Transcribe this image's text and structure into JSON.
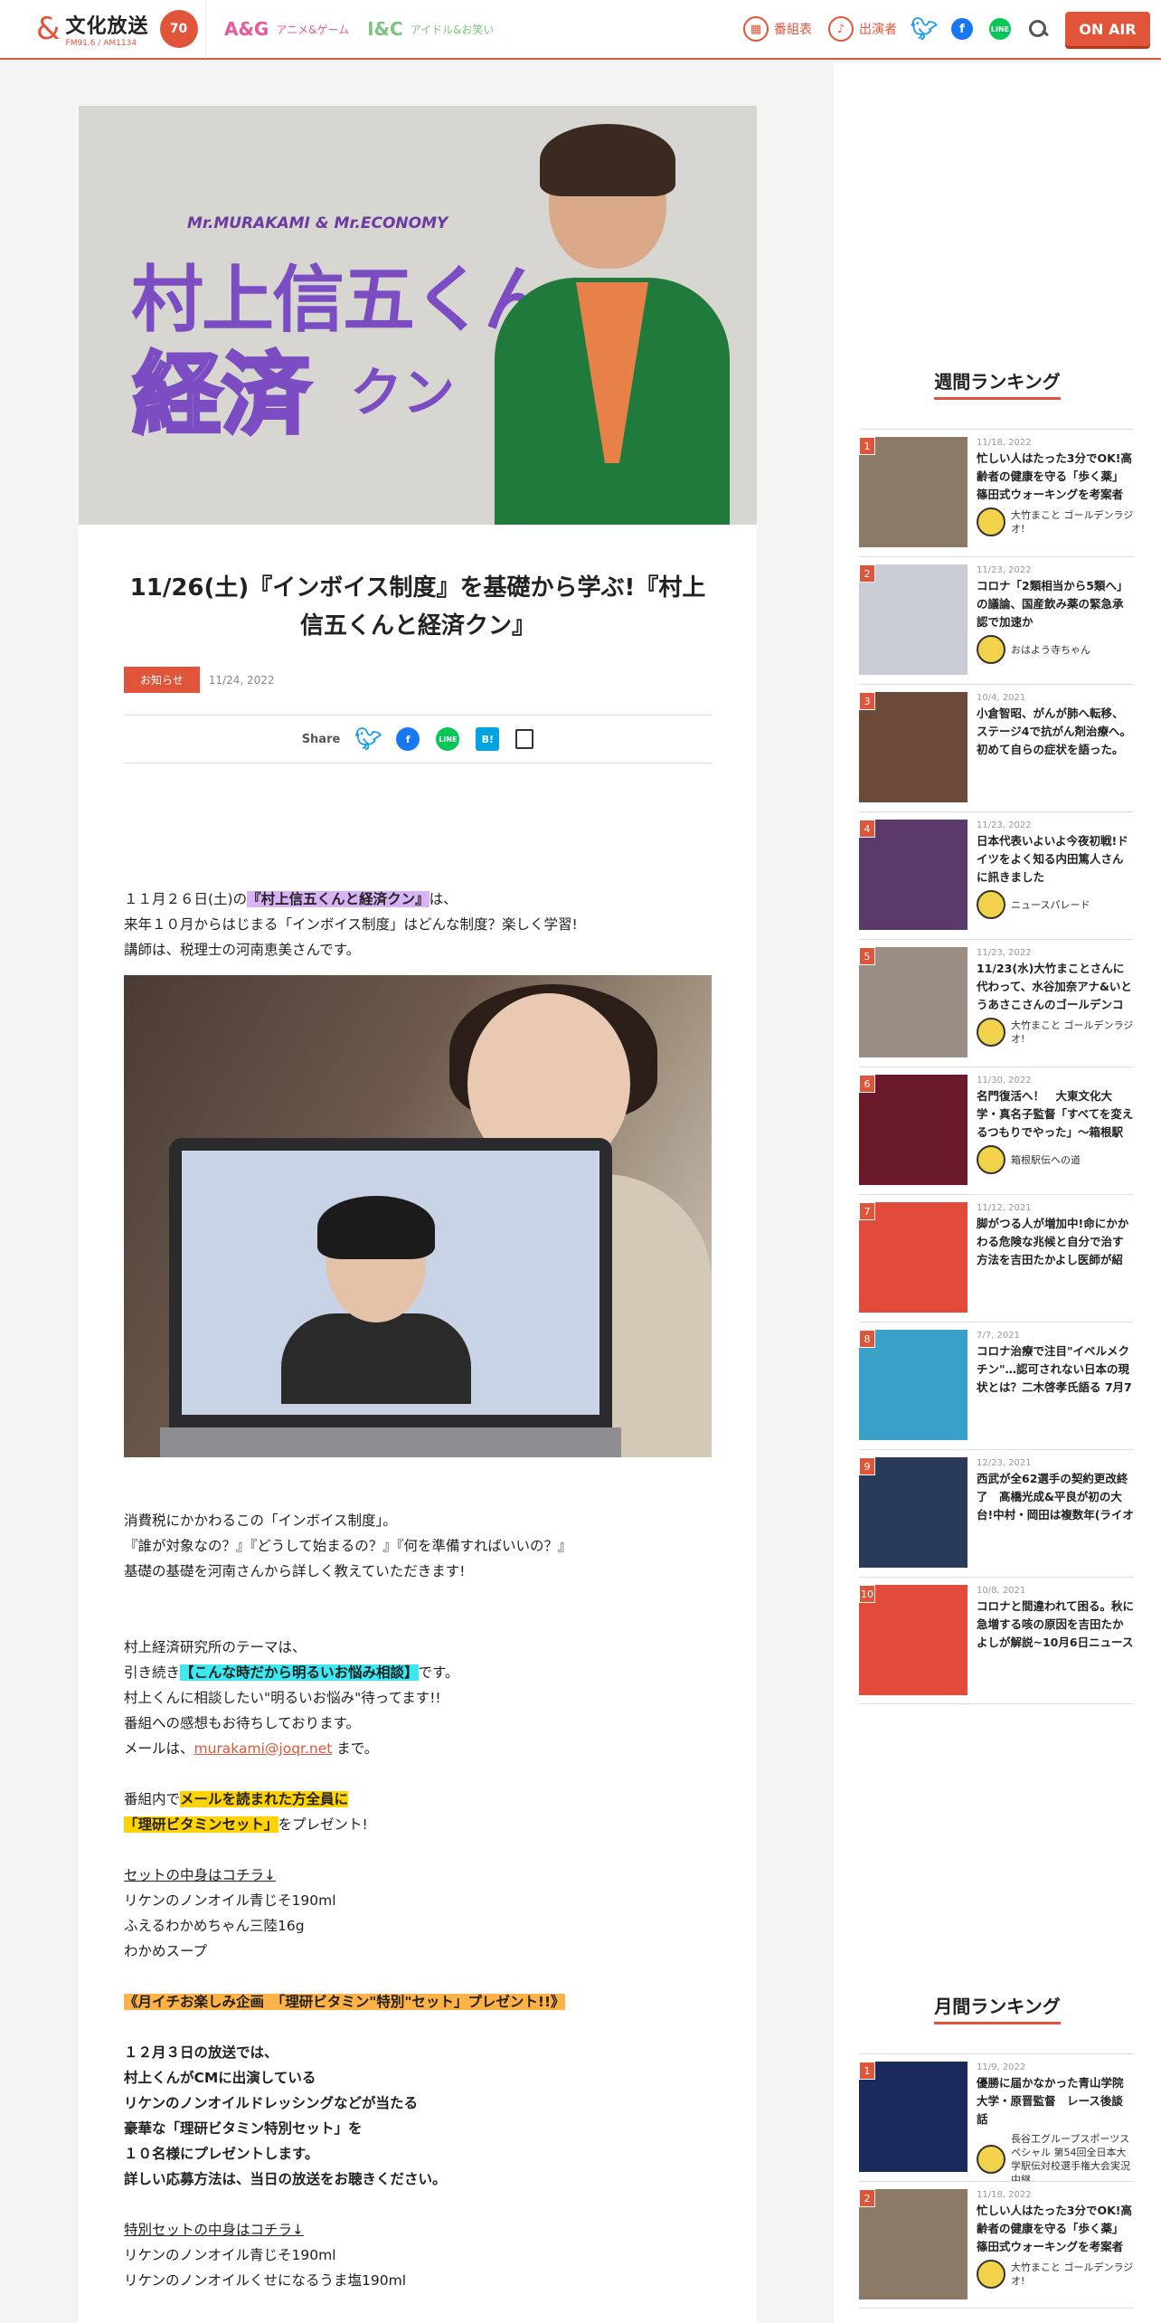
{
  "header": {
    "logo_text": "文化放送",
    "logo_sub": "FM91.6 / AM1134",
    "logo_badge": "70",
    "sections": [
      {
        "badge": "A&G",
        "label": "アニメ&ゲーム"
      },
      {
        "badge": "I&C",
        "label": "アイドル&お笑い"
      }
    ],
    "nav": {
      "schedule": "番組表",
      "cast": "出演者"
    },
    "onair": "ON AIR"
  },
  "hero": {
    "sub": "Mr.MURAKAMI & Mr.ECONOMY",
    "title1": "村上信五くん",
    "title2": "経済",
    "title3": "クン"
  },
  "article": {
    "title": "11/26(土)『インボイス制度』を基礎から学ぶ!『村上信五くんと経済クン』",
    "tag": "お知らせ",
    "date": "11/24, 2022",
    "share_label": "Share",
    "p1_pre": "１１月２６日(土)の",
    "p1_hl": "『村上信五くんと経済クン』",
    "p1_post": "は、",
    "p2": "来年１０月からはじまる「インボイス制度」はどんな制度？楽しく学習!",
    "p3": "講師は、税理士の河南恵美さんです。",
    "p4": "消費税にかかわるこの「インボイス制度」。",
    "p5": "『誰が対象なの？』『どうして始まるの？』『何を準備すればいいの？』",
    "p6": "基礎の基礎を河南さんから詳しく教えていただきます!",
    "p7": "村上経済研究所のテーマは、",
    "p8_pre": "引き続き",
    "p8_hl": "【こんな時だから明るいお悩み相談】",
    "p8_post": "です。",
    "p9": "村上くんに相談したい\"明るいお悩み\"待ってます!!",
    "p10": "番組への感想もお待ちしております。",
    "p11_pre": "メールは、",
    "p11_link": "murakami@joqr.net",
    "p11_post": " まで。",
    "p12_pre": "番組内で",
    "p12_hl": "メールを読まれた方全員に",
    "p13_hl": "「理研ビタミンセット」",
    "p13_post": "をプレゼント!",
    "p14": "セットの中身はコチラ↓",
    "p15": "リケンのノンオイル青じそ190ml",
    "p16": "ふえるわかめちゃん三陸16g",
    "p17": "わかめスープ",
    "p18_hl": "《月イチお楽しみ企画　「理研ビタミン\"特別\"セット」プレゼント!!》",
    "p19": "１２月３日の放送では、",
    "p20": "村上くんがCMに出演している",
    "p21": "リケンのノンオイルドレッシングなどが当たる",
    "p22": "豪華な「理研ビタミン特別セット」を",
    "p23": "１０名様にプレゼントします。",
    "p24": "詳しい応募方法は、当日の放送をお聴きください。",
    "p25": "特別セットの中身はコチラ↓",
    "p26": "リケンのノンオイル青じそ190ml",
    "p27": "リケンのノンオイルくせになるうま塩190ml"
  },
  "sidebar": {
    "weekly_heading": "週間ランキング",
    "weekly": [
      {
        "rank": "1",
        "date": "11/18, 2022",
        "title": "忙しい人はたった3分でOK!高齢者の健康を守る「歩く薬」篠田式ウォーキングを考案者自",
        "source": "大竹まこと ゴールデンラジオ!",
        "thumb": "#8a7a66"
      },
      {
        "rank": "2",
        "date": "11/23, 2022",
        "title": "コロナ「2類相当から5類へ」の議論、国産飲み薬の緊急承認で加速か",
        "source": "おはよう寺ちゃん",
        "thumb": "#c9ccd2"
      },
      {
        "rank": "3",
        "date": "10/4, 2021",
        "title": "小倉智昭、がんが肺へ転移、ステージ4で抗がん剤治療へ。初めて自らの症状を語った。～",
        "source": "",
        "thumb": "#6b4a3a"
      },
      {
        "rank": "4",
        "date": "11/23, 2022",
        "title": "日本代表いよいよ今夜初戦!ドイツをよく知る内田篤人さんに訊きました",
        "source": "ニュースパレード",
        "thumb": "#5a3a6a"
      },
      {
        "rank": "5",
        "date": "11/23, 2022",
        "title": "11/23(水)大竹まことさんに代わって、水谷加奈アナ&いとうあさこさんのゴールデンコン",
        "source": "大竹まこと ゴールデンラジオ!",
        "thumb": "#9a8e84"
      },
      {
        "rank": "6",
        "date": "11/30, 2022",
        "title": "名門復活へ！　大東文化大学・真名子監督「すべてを変えるつもりでやった」～箱根駅伝への",
        "source": "箱根駅伝への道",
        "thumb": "#6a1a2a"
      },
      {
        "rank": "7",
        "date": "11/12, 2021",
        "title": "脚がつる人が増加中!命にかかわる危険な兆候と自分で治す方法を吉田たかよし医師が紹",
        "source": "",
        "thumb": "#e24a3a"
      },
      {
        "rank": "8",
        "date": "7/7, 2021",
        "title": "コロナ治療で注目\"イベルメクチン\"…認可されない日本の現状とは？二木啓孝氏語る 7月7",
        "source": "",
        "thumb": "#3aa0c8"
      },
      {
        "rank": "9",
        "date": "12/23, 2021",
        "title": "西武が全62選手の契約更改終了　髙橋光成&平良が初の大台!中村・岡田は複数年(ライオ",
        "source": "",
        "thumb": "#2a3a5a"
      },
      {
        "rank": "10",
        "date": "10/8, 2021",
        "title": "コロナと間違われて困る。秋に急増する咳の原因を吉田たかよしが解説~10月6日ニュース",
        "source": "",
        "thumb": "#e24a3a"
      }
    ],
    "monthly_heading": "月間ランキング",
    "monthly": [
      {
        "rank": "1",
        "date": "11/9, 2022",
        "title": "優勝に届かなかった青山学院大学・原晋監督　レース後談話",
        "source": "長谷工グループスポーツスペシャル 第54回全日本大学駅伝対校選手権大会実況中継",
        "thumb": "#1a2a5a"
      },
      {
        "rank": "2",
        "date": "11/18, 2022",
        "title": "忙しい人はたった3分でOK!高齢者の健康を守る「歩く薬」篠田式ウォーキングを考案者自",
        "source": "大竹まこと ゴールデンラジオ!",
        "thumb": "#8a7a66"
      }
    ]
  }
}
